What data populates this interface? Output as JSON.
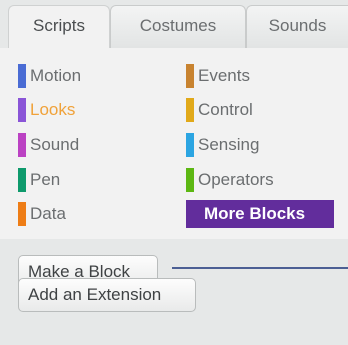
{
  "tabs": [
    {
      "label": "Scripts"
    },
    {
      "label": "Costumes"
    },
    {
      "label": "Sounds"
    }
  ],
  "active_tab": "Scripts",
  "categories": [
    {
      "label": "Motion",
      "color": "#4a6cd4"
    },
    {
      "label": "Looks",
      "color": "#8a55d7"
    },
    {
      "label": "Sound",
      "color": "#bb42c3"
    },
    {
      "label": "Pen",
      "color": "#0e9a6c"
    },
    {
      "label": "Data",
      "color": "#ee7d16"
    },
    {
      "label": "Events",
      "color": "#c88330"
    },
    {
      "label": "Control",
      "color": "#e1a91a"
    },
    {
      "label": "Sensing",
      "color": "#2ca5e2"
    },
    {
      "label": "Operators",
      "color": "#5cb712"
    },
    {
      "label": "More Blocks",
      "color": "#632d99"
    }
  ],
  "selected_category": "Looks",
  "buttons": {
    "make_block": "Make a Block",
    "add_extension": "Add an Extension"
  }
}
